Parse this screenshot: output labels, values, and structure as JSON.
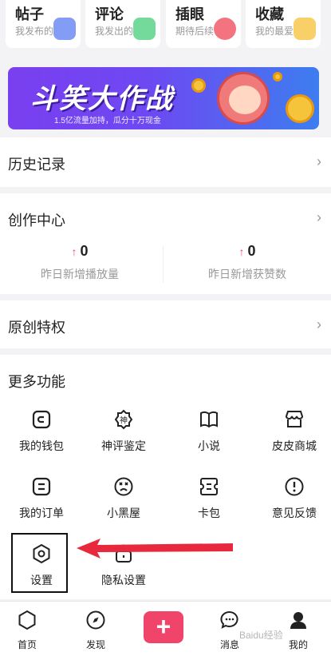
{
  "top_cards": [
    {
      "title": "帖子",
      "subtitle": "我发布的"
    },
    {
      "title": "评论",
      "subtitle": "我发出的"
    },
    {
      "title": "插眼",
      "subtitle": "期待后续"
    },
    {
      "title": "收藏",
      "subtitle": "我的最爱"
    }
  ],
  "banner": {
    "title": "斗笑大作战",
    "subtitle": "1.5亿流量加持，瓜分十万现金"
  },
  "history": {
    "label": "历史记录",
    "chevron": "›"
  },
  "creation": {
    "label": "创作中心",
    "chevron": "›",
    "stats": [
      {
        "arrow": "↑",
        "value": "0",
        "label": "昨日新增播放量"
      },
      {
        "arrow": "↑",
        "value": "0",
        "label": "昨日新增获赞数"
      }
    ]
  },
  "original": {
    "label": "原创特权",
    "chevron": "›"
  },
  "more": {
    "label": "更多功能",
    "items": [
      {
        "label": "我的钱包",
        "icon": "wallet-icon"
      },
      {
        "label": "神评鉴定",
        "icon": "shen-badge-icon"
      },
      {
        "label": "小说",
        "icon": "book-icon"
      },
      {
        "label": "皮皮商城",
        "icon": "shop-icon"
      },
      {
        "label": "我的订单",
        "icon": "order-icon"
      },
      {
        "label": "小黑屋",
        "icon": "dizzy-face-icon"
      },
      {
        "label": "卡包",
        "icon": "card-pack-icon"
      },
      {
        "label": "意见反馈",
        "icon": "feedback-icon"
      },
      {
        "label": "设置",
        "icon": "settings-hex-icon"
      },
      {
        "label": "隐私设置",
        "icon": "privacy-lock-icon"
      }
    ]
  },
  "bottom_nav": [
    {
      "label": "首页",
      "icon": "home-icon"
    },
    {
      "label": "发现",
      "icon": "compass-icon"
    },
    {
      "label": "",
      "icon": "plus-icon"
    },
    {
      "label": "消息",
      "icon": "message-icon"
    },
    {
      "label": "我的",
      "icon": "profile-icon"
    }
  ],
  "plus_symbol": "+",
  "watermark": "Baidu经验",
  "colors": {
    "accent": "#f0446a",
    "annotation_arrow": "#e8283c"
  }
}
